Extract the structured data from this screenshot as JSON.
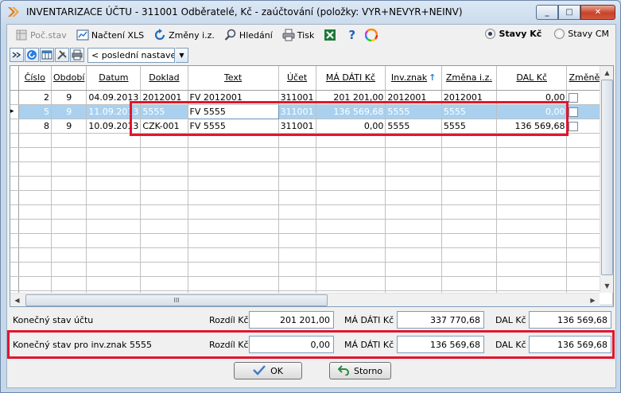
{
  "window": {
    "title": "INVENTARIZACE ÚČTU - 311001  Odběratelé, Kč - zaúčtování   (položky: VYR+NEVYR+NEINV)",
    "btn_min": "_",
    "btn_max": "□",
    "btn_close": "✕"
  },
  "toolbar": {
    "poc_stav": "Poč.stav",
    "nacteni_xls": "Načtení XLS",
    "zmeny_iz": "Změny i.z.",
    "hledani": "Hledání",
    "tisk": "Tisk",
    "help": "?",
    "radio_kc": "Stavy Kč",
    "radio_cm": "Stavy CM"
  },
  "layout_combo": {
    "value": "< poslední nastave",
    "arrow": "▼"
  },
  "grid": {
    "columns": [
      "Číslo",
      "Období",
      "Datum",
      "Doklad",
      "Text",
      "Účet",
      "MÁ DÁTI  Kč",
      "Inv.znak",
      "Změna i.z.",
      "DAL  Kč",
      "Změněno"
    ],
    "sort_marker": "↑",
    "rows": [
      {
        "cislo": "2",
        "obdobi": "9",
        "datum": "04.09.2013",
        "doklad": "2012001",
        "text": "FV 2012001",
        "ucet": "311001",
        "ma_dati": "201 201,00",
        "inv_znak": "2012001",
        "zmena": "2012001",
        "dal": "0,00"
      },
      {
        "cislo": "5",
        "obdobi": "9",
        "datum": "11.09.2013",
        "doklad": "5555",
        "text": "FV 5555",
        "ucet": "311001",
        "ma_dati": "136 569,68",
        "inv_znak": "5555",
        "zmena": "5555",
        "dal": "0,00"
      },
      {
        "cislo": "8",
        "obdobi": "9",
        "datum": "10.09.2013",
        "doklad": "CZK-001",
        "text": "FV 5555",
        "ucet": "311001",
        "ma_dati": "0,00",
        "inv_znak": "5555",
        "zmena": "5555",
        "dal": "136 569,68"
      }
    ],
    "row_indicator": "▸",
    "hscroll_grip": "III"
  },
  "summary": {
    "row1": {
      "label": "Konečný stav účtu",
      "rozdil_label": "Rozdíl Kč",
      "rozdil": "201 201,00",
      "ma_dati_label": "MÁ DÁTI Kč",
      "ma_dati": "337 770,68",
      "dal_label": "DAL Kč",
      "dal": "136 569,68"
    },
    "row2": {
      "label": "Konečný stav pro inv.znak 5555",
      "rozdil_label": "Rozdíl Kč",
      "rozdil": "0,00",
      "ma_dati_label": "MÁ DÁTI Kč",
      "ma_dati": "136 569,68",
      "dal_label": "DAL Kč",
      "dal": "136 569,68"
    }
  },
  "buttons": {
    "ok": "OK",
    "storno": "Storno"
  },
  "colors": {
    "highlight": "#e0162e",
    "selected_row": "#a9d1ef",
    "accent": "#2b7fd1"
  }
}
